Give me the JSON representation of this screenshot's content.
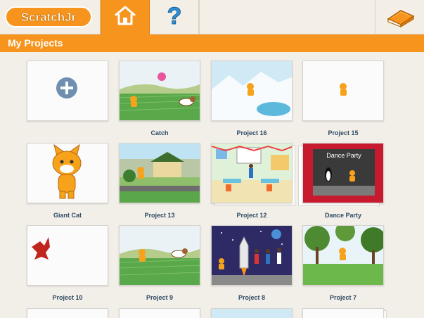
{
  "app": {
    "logo_text": "ScratchJr",
    "tabs": [
      {
        "name": "home",
        "icon": "house-icon",
        "active": true
      },
      {
        "name": "help",
        "icon": "question-mark-icon",
        "active": false
      }
    ],
    "book_icon": "book-icon",
    "accent_color": "#f7941d"
  },
  "section": {
    "title": "My Projects"
  },
  "new_project": {
    "icon": "plus-circle-icon"
  },
  "projects": [
    {
      "title": "Catch"
    },
    {
      "title": "Project 16"
    },
    {
      "title": "Project 15"
    },
    {
      "title": "Giant Cat"
    },
    {
      "title": "Project 13"
    },
    {
      "title": "Project 12"
    },
    {
      "title": "Dance Party",
      "stage_text": "Dance Party"
    },
    {
      "title": "Project 10"
    },
    {
      "title": "Project 9"
    },
    {
      "title": "Project 8"
    },
    {
      "title": "Project 7"
    }
  ]
}
